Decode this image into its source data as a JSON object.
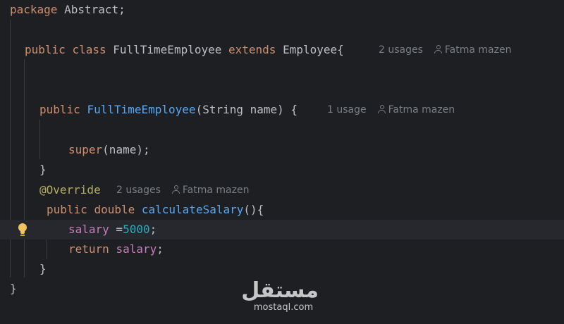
{
  "editor": {
    "line1": {
      "kw_package": "package",
      "pkg_name": " Abstract;"
    },
    "line2": {
      "kw_public": "public",
      "kw_class": "class",
      "class_name": " FullTimeEmployee ",
      "kw_extends": "extends",
      "parent": " Employee{",
      "usages": "2 usages",
      "author": "Fatma mazen"
    },
    "line3": {
      "kw_public": "public",
      "ctor_name": "FullTimeEmployee",
      "params": "(String name) {",
      "usages": "1 usage",
      "author": "Fatma mazen"
    },
    "line4": {
      "kw_super": "super",
      "args": "(name);"
    },
    "line5": {
      "brace": "}"
    },
    "line6": {
      "annotation": "@Override",
      "usages": "2 usages",
      "author": "Fatma mazen"
    },
    "line7": {
      "kw_public": "public",
      "kw_double": "double",
      "method_name": "calculateSalary",
      "rest": "(){"
    },
    "line8": {
      "var": "salary",
      "op": " =",
      "num": "5000",
      "semi": ";"
    },
    "line9": {
      "kw_return": "return",
      "var": "salary",
      "semi": ";"
    },
    "line10": {
      "brace": "}"
    },
    "line11": {
      "brace": "}"
    }
  },
  "watermark": {
    "brand": "مستقل",
    "site": "mostaql.com"
  },
  "colors": {
    "background": "#1e1f22",
    "keyword": "#cf8e6d",
    "function": "#56a8f5",
    "field": "#c77dbb",
    "number": "#2aacb8",
    "annotation": "#b3ae60",
    "hint": "#7a7e85",
    "bulb": "#f2c55c"
  },
  "icons": [
    "user-icon",
    "lightbulb-icon"
  ]
}
